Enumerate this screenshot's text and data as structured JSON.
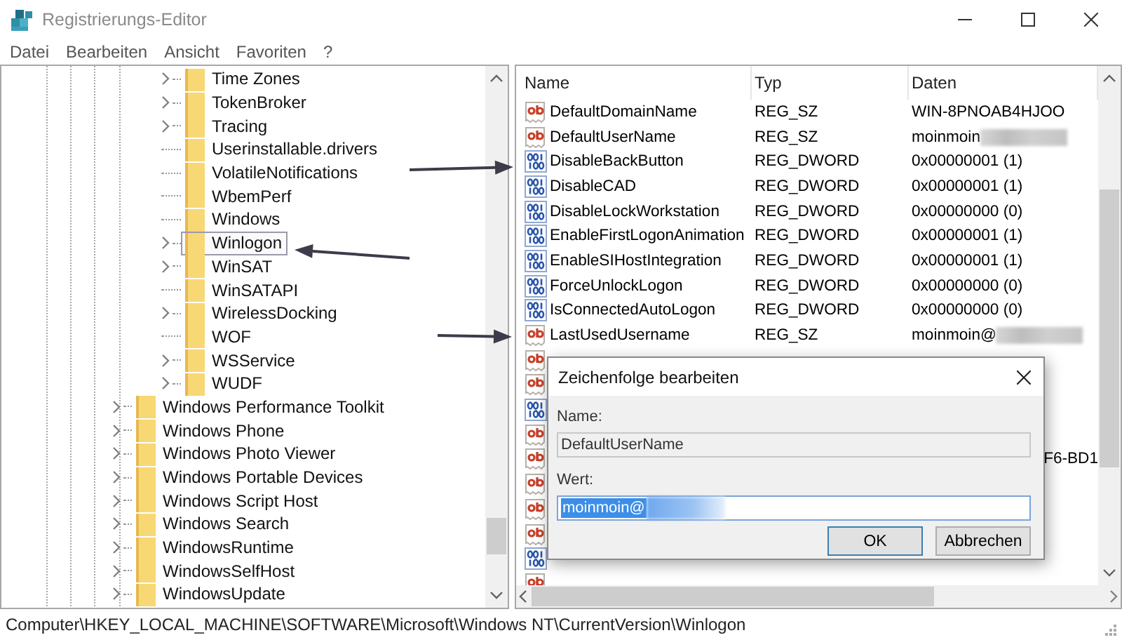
{
  "window": {
    "title": "Registrierungs-Editor"
  },
  "menu": [
    "Datei",
    "Bearbeiten",
    "Ansicht",
    "Favoriten",
    "?"
  ],
  "tree": {
    "continued_children": [
      {
        "label": "Time Zones",
        "expandable": true,
        "selected": false
      },
      {
        "label": "TokenBroker",
        "expandable": true,
        "selected": false
      },
      {
        "label": "Tracing",
        "expandable": true,
        "selected": false
      },
      {
        "label": "Userinstallable.drivers",
        "expandable": false,
        "selected": false
      },
      {
        "label": "VolatileNotifications",
        "expandable": false,
        "selected": false
      },
      {
        "label": "WbemPerf",
        "expandable": false,
        "selected": false
      },
      {
        "label": "Windows",
        "expandable": false,
        "selected": false
      },
      {
        "label": "Winlogon",
        "expandable": true,
        "selected": true
      },
      {
        "label": "WinSAT",
        "expandable": true,
        "selected": false
      },
      {
        "label": "WinSATAPI",
        "expandable": false,
        "selected": false
      },
      {
        "label": "WirelessDocking",
        "expandable": true,
        "selected": false
      },
      {
        "label": "WOF",
        "expandable": false,
        "selected": false
      },
      {
        "label": "WSService",
        "expandable": true,
        "selected": false
      },
      {
        "label": "WUDF",
        "expandable": true,
        "selected": false
      }
    ],
    "items": [
      {
        "label": "Windows Performance Toolkit",
        "expandable": true,
        "selected": false
      },
      {
        "label": "Windows Phone",
        "expandable": true,
        "selected": false
      },
      {
        "label": "Windows Photo Viewer",
        "expandable": true,
        "selected": false
      },
      {
        "label": "Windows Portable Devices",
        "expandable": true,
        "selected": false
      },
      {
        "label": "Windows Script Host",
        "expandable": true,
        "selected": false
      },
      {
        "label": "Windows Search",
        "expandable": true,
        "selected": false
      },
      {
        "label": "WindowsRuntime",
        "expandable": true,
        "selected": false
      },
      {
        "label": "WindowsSelfHost",
        "expandable": true,
        "selected": false
      },
      {
        "label": "WindowsUpdate",
        "expandable": true,
        "selected": false
      }
    ]
  },
  "list": {
    "columns": [
      "Name",
      "Typ",
      "Daten"
    ],
    "rows": [
      {
        "kind": "string",
        "name": "DefaultDomainName",
        "type": "REG_SZ",
        "data": "WIN-8PNOAB4HJOO"
      },
      {
        "kind": "string",
        "name": "DefaultUserName",
        "type": "REG_SZ",
        "data": "moinmoin",
        "redacted": true
      },
      {
        "kind": "dword",
        "name": "DisableBackButton",
        "type": "REG_DWORD",
        "data": "0x00000001 (1)"
      },
      {
        "kind": "dword",
        "name": "DisableCAD",
        "type": "REG_DWORD",
        "data": "0x00000001 (1)"
      },
      {
        "kind": "dword",
        "name": "DisableLockWorkstation",
        "type": "REG_DWORD",
        "data": "0x00000000 (0)"
      },
      {
        "kind": "dword",
        "name": "EnableFirstLogonAnimation",
        "type": "REG_DWORD",
        "data": "0x00000001 (1)"
      },
      {
        "kind": "dword",
        "name": "EnableSIHostIntegration",
        "type": "REG_DWORD",
        "data": "0x00000001 (1)"
      },
      {
        "kind": "dword",
        "name": "ForceUnlockLogon",
        "type": "REG_DWORD",
        "data": "0x00000000 (0)"
      },
      {
        "kind": "dword",
        "name": "IsConnectedAutoLogon",
        "type": "REG_DWORD",
        "data": "0x00000000 (0)"
      },
      {
        "kind": "string",
        "name": "LastUsedUsername",
        "type": "REG_SZ",
        "data": "moinmoin@",
        "redacted": true
      },
      {
        "kind": "string"
      },
      {
        "kind": "string"
      },
      {
        "kind": "dword"
      },
      {
        "kind": "string"
      },
      {
        "kind": "string",
        "data_tail": "F6-BD1"
      },
      {
        "kind": "string"
      },
      {
        "kind": "string"
      },
      {
        "kind": "string"
      },
      {
        "kind": "dword"
      },
      {
        "kind": "string"
      }
    ]
  },
  "dialog": {
    "title": "Zeichenfolge bearbeiten",
    "name_label": "Name:",
    "name_value": "DefaultUserName",
    "value_label": "Wert:",
    "value": "moinmoin@",
    "value_selected": true,
    "redacted": true,
    "buttons": [
      {
        "label": "OK",
        "default": true
      },
      {
        "label": "Abbrechen",
        "default": false
      }
    ]
  },
  "status_bar": "Computer\\HKEY_LOCAL_MACHINE\\SOFTWARE\\Microsoft\\Windows NT\\CurrentVersion\\Winlogon"
}
